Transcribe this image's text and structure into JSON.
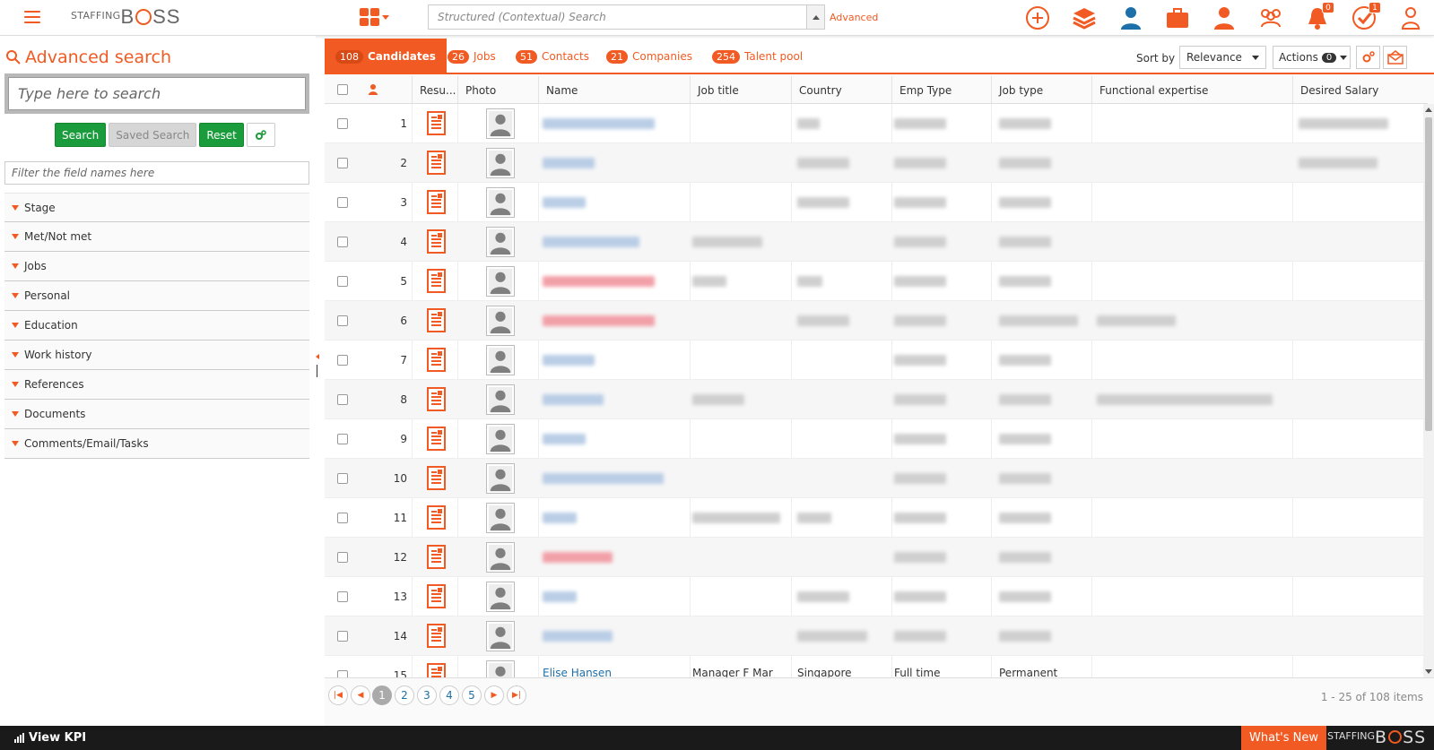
{
  "app": {
    "logo_small": "STAFFING",
    "logo_big_b": "B",
    "logo_big_rest": "SS"
  },
  "header": {
    "search_placeholder": "Structured (Contextual) Search",
    "advanced_link": "Advanced",
    "icons": [
      "add-icon",
      "layers-icon",
      "candidate-icon",
      "briefcase-icon",
      "contact-icon",
      "talent-pool-icon",
      "bell-icon",
      "tasks-icon",
      "user-profile-icon"
    ],
    "notifications_count": "0",
    "tasks_count": "1"
  },
  "left": {
    "title": "Advanced search",
    "search_placeholder": "Type here to search",
    "buttons": {
      "search": "Search",
      "saved": "Saved Search",
      "reset": "Reset"
    },
    "filter_placeholder": "Filter the field names here",
    "sections": [
      "Stage",
      "Met/Not met",
      "Jobs",
      "Personal",
      "Education",
      "Work history",
      "References",
      "Documents",
      "Comments/Email/Tasks"
    ]
  },
  "tabs": [
    {
      "count": "108",
      "label": "Candidates"
    },
    {
      "count": "26",
      "label": "Jobs"
    },
    {
      "count": "51",
      "label": "Contacts"
    },
    {
      "count": "21",
      "label": "Companies"
    },
    {
      "count": "254",
      "label": "Talent pool"
    }
  ],
  "toolbar": {
    "sort_label": "Sort by",
    "sort_value": "Relevance",
    "actions_label": "Actions",
    "actions_count": "0"
  },
  "grid": {
    "columns": [
      "Resu...",
      "Photo",
      "Name",
      "Job title",
      "Country",
      "Emp Type",
      "Job type",
      "Functional expertise",
      "Desired Salary"
    ],
    "rows": [
      "1",
      "2",
      "3",
      "4",
      "5",
      "6",
      "7",
      "8",
      "9",
      "10",
      "11",
      "12",
      "13",
      "14",
      "15"
    ],
    "partial_row": {
      "name": "Elise Hansen",
      "job_title": "Manager F Mar",
      "country": "Singapore",
      "emp_type": "Full time",
      "job_type": "Permanent"
    },
    "colors": {
      "accent": "#f15a22",
      "link": "#1c6fa8",
      "blur_blue": "#b9cde6",
      "blur_red": "#f2a0a8",
      "blur_gray": "#cfcfcf"
    }
  },
  "pager": {
    "pages": [
      "1",
      "2",
      "3",
      "4",
      "5"
    ],
    "current": "1",
    "info": "1 - 25 of 108 items"
  },
  "footer": {
    "kpi": "View KPI",
    "whats_new": "What's New",
    "logo_small": "STAFFING",
    "logo_big_b": "B",
    "logo_big_rest": "SS"
  }
}
